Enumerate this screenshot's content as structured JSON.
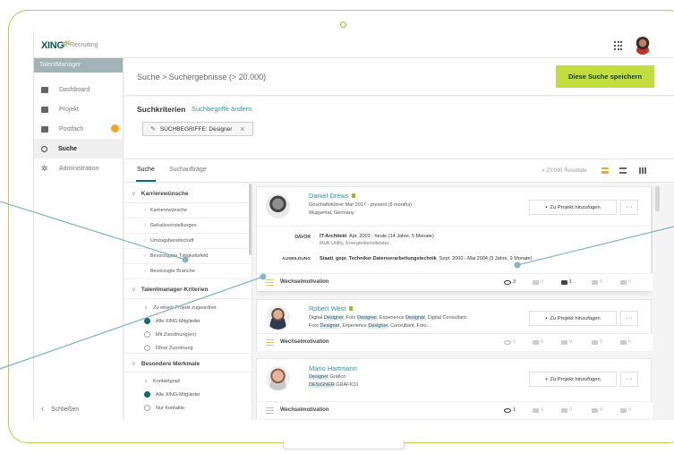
{
  "app": {
    "logo": "XING",
    "product": "E-Recruiting"
  },
  "sidebar": {
    "title": "TalentManager",
    "items": [
      {
        "label": "Dashboard",
        "icon": "dashboard-icon"
      },
      {
        "label": "Projekt",
        "icon": "folder-icon"
      },
      {
        "label": "Postfach",
        "icon": "mail-icon",
        "badge": true
      },
      {
        "label": "Suche",
        "icon": "search-icon",
        "active": true
      },
      {
        "label": "Administration",
        "icon": "gear-icon"
      }
    ],
    "close_label": "Schließen"
  },
  "header": {
    "breadcrumb": "Suche > Suchergebnisse (> 20.000)",
    "save_button": "Diese Suche speichern"
  },
  "criteria": {
    "title": "Suchkriterien",
    "edit_link": "Suchbegriffe ändern",
    "chip": "SUCHBEGRIFFE: Designer"
  },
  "tabs": {
    "items": [
      "Suche",
      "Suchaufträge"
    ],
    "results_count": "> 20.000 Resultate"
  },
  "filters": {
    "sections": [
      {
        "title": "Karrierewünsche",
        "items": [
          "Karrierewünsche",
          "Gehaltsvorstellungen",
          "Umzugsbereitschaft",
          "Bevorzugtes Tätigkeitsfeld",
          "Bevorzugte Branche"
        ]
      },
      {
        "title": "Talentmanager-Kriterien",
        "group": "Zu einem Projekt zugeordnet",
        "options": [
          "Alle XING-Mitglieder",
          "Mit Zuordnung(en)",
          "Ohne Zuordnung"
        ]
      },
      {
        "title": "Besondere Merkmale",
        "group": "Kontaktgrad",
        "options": [
          "Alle XING-Mitglieder",
          "Nur Kontakte"
        ]
      }
    ]
  },
  "results": [
    {
      "name": "Daniel Drews",
      "line1": "Geschäftsführer  Mar 2017 - present (6 months)",
      "line2": "Wuppertal, Germany",
      "history": [
        {
          "label": "DAVOR",
          "title": "IT-Architekt",
          "detail": "Apr. 2003 - heute (14 Jahre, 5 Monate)",
          "sub": "Multi Utility, Energiedienstleister"
        },
        {
          "label": "AUSBILDUNG",
          "title": "Staatl. gepr. Techniker Datenverarbeitungstechnik",
          "detail": "Sept. 2000 - Mai 2004 (3 Jahre, 9 Monate)"
        }
      ],
      "motivation": "Wechselmotivation",
      "stats": [
        "3",
        "0",
        "1",
        "0",
        "0"
      ]
    },
    {
      "name": "Robert West",
      "line1_parts": [
        "Digital ",
        "Designer",
        ", Foto ",
        "Designer",
        ", Experience ",
        "Designer",
        ", Digital Consultant,"
      ],
      "line2_parts": [
        "Foto ",
        "Designer",
        ", Experience ",
        "Designer",
        ", Consultant, Foto..."
      ],
      "motivation": "Wechselmotivation",
      "stats": [
        "0",
        "0",
        "0",
        "0",
        "0"
      ]
    },
    {
      "name": "Mario Hartmann",
      "line1_parts": [
        "Designer",
        " Gráfico"
      ],
      "line2_parts": [
        "DESIGNER",
        " GRÁFICO"
      ],
      "motivation": "Wechselmotivation",
      "stats": [
        "1",
        "0",
        "0",
        "0",
        "0"
      ]
    }
  ],
  "project_button": "Zu Projekt hinzufügen",
  "more_button": "···",
  "colors": {
    "brand_green": "#c3dc3e",
    "teal": "#0e6a6e",
    "link": "#2c9aa0",
    "accent_orange": "#f5a623",
    "frame": "#b7cf4a",
    "callout": "#86b4c2"
  }
}
